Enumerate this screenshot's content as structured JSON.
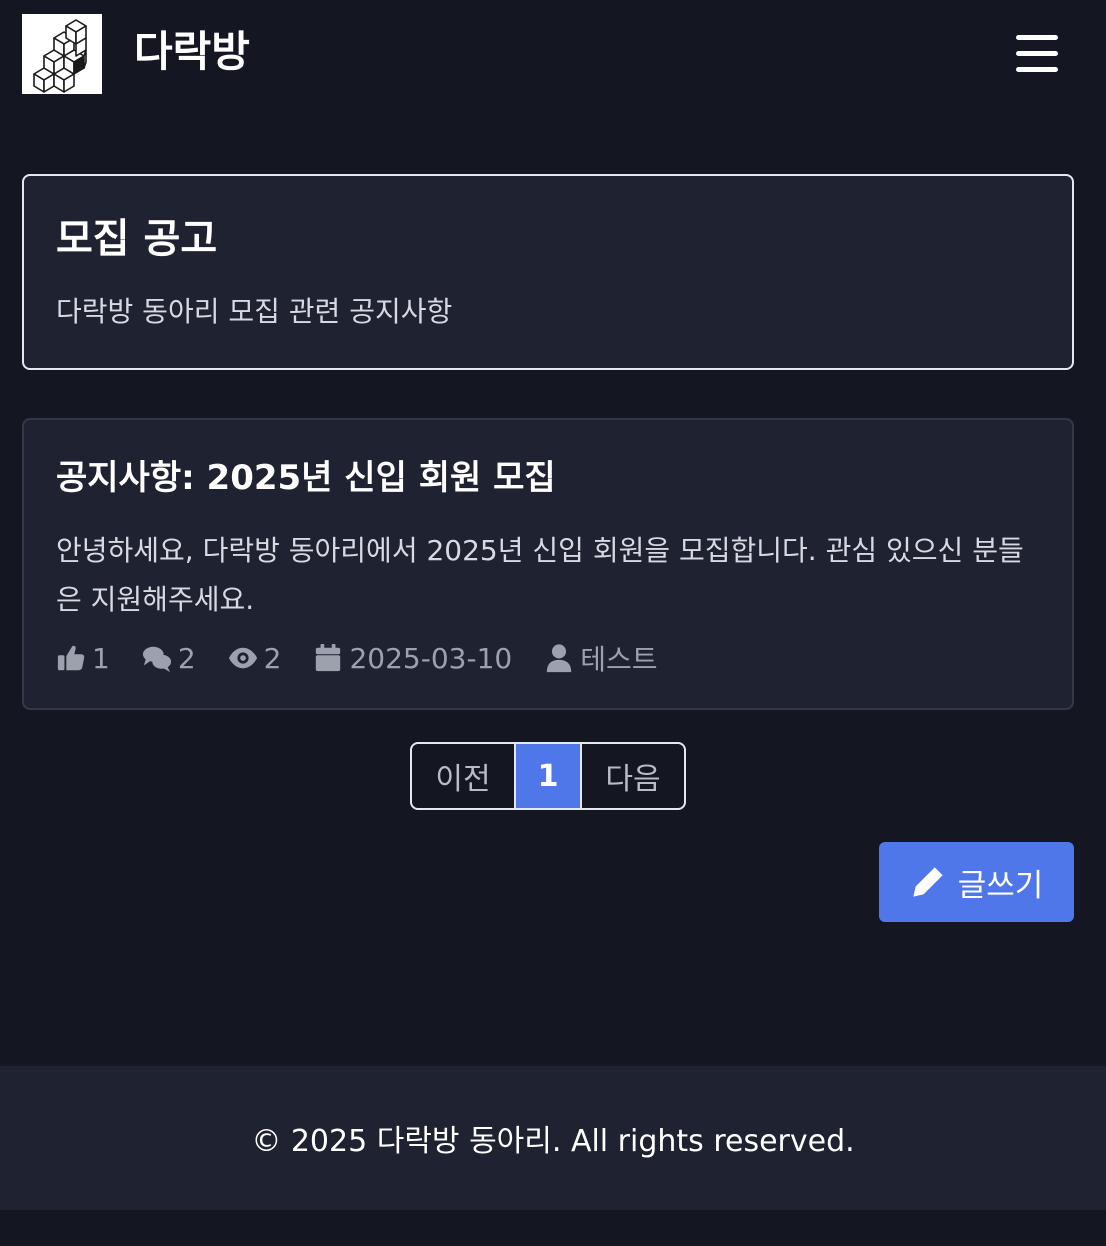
{
  "header": {
    "site_title": "다락방",
    "logo_icon": "stacked-cubes-logo",
    "menu_icon": "hamburger-menu-icon"
  },
  "board": {
    "title": "모집 공고",
    "description": "다락방 동아리 모집 관련 공지사항"
  },
  "posts": [
    {
      "title": "공지사항: 2025년 신입 회원 모집",
      "excerpt": "안녕하세요, 다락방 동아리에서 2025년 신입 회원을 모집합니다. 관심 있으신 분들은 지원해주세요.",
      "likes": "1",
      "comments": "2",
      "views": "2",
      "date": "2025-03-10",
      "author": "테스트"
    }
  ],
  "pagination": {
    "prev_label": "이전",
    "current_page": "1",
    "next_label": "다음"
  },
  "actions": {
    "write_label": "글쓰기",
    "write_icon": "pencil-icon"
  },
  "footer": {
    "copyright": "© 2025 다락방 동아리. All rights reserved."
  },
  "colors": {
    "background": "#141622",
    "card": "#1f2230",
    "accent": "#4f77ea",
    "meta_text": "#9ca1ad"
  }
}
